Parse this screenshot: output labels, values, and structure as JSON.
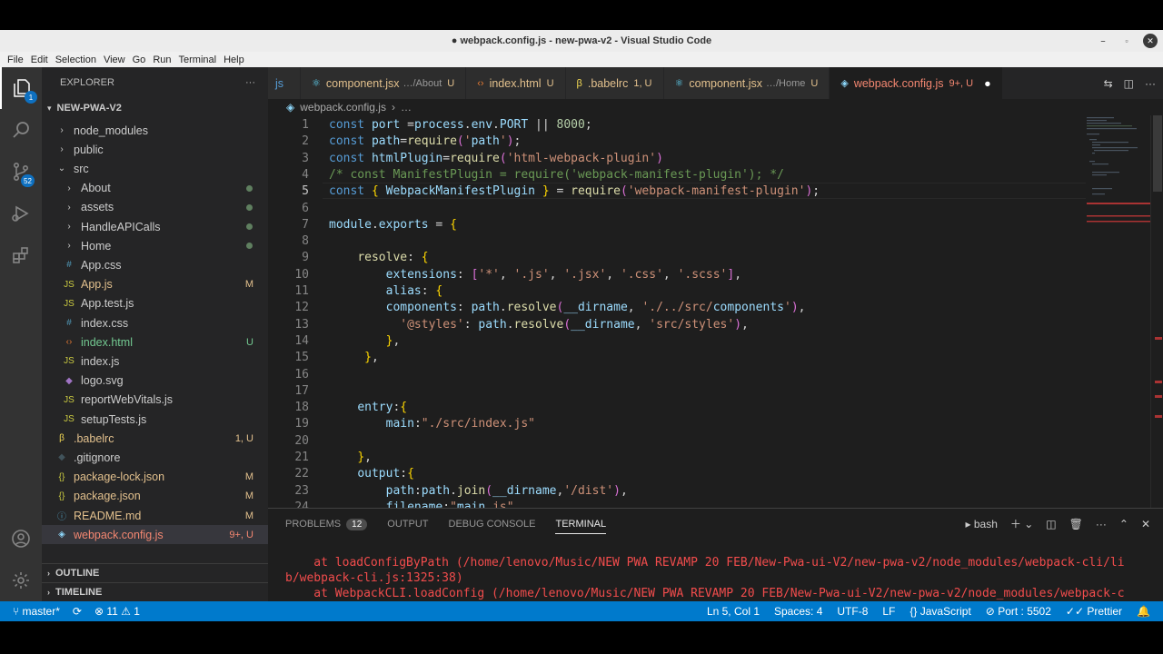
{
  "window": {
    "title": "● webpack.config.js - new-pwa-v2 - Visual Studio Code"
  },
  "menu": [
    "File",
    "Edit",
    "Selection",
    "View",
    "Go",
    "Run",
    "Terminal",
    "Help"
  ],
  "activity": {
    "explorer_badge": "1",
    "scm_badge": "52"
  },
  "explorer": {
    "header": "EXPLORER",
    "more": "···",
    "project": "NEW-PWA-V2",
    "items": [
      {
        "label": "node_modules",
        "kind": "folder",
        "indent": 1,
        "status": ""
      },
      {
        "label": "public",
        "kind": "folder",
        "indent": 1,
        "status": ""
      },
      {
        "label": "src",
        "kind": "folder-open",
        "indent": 1,
        "status": ""
      },
      {
        "label": "About",
        "kind": "folder",
        "indent": 2,
        "status": "dot"
      },
      {
        "label": "assets",
        "kind": "folder",
        "indent": 2,
        "status": "dot"
      },
      {
        "label": "HandleAPICalls",
        "kind": "folder",
        "indent": 2,
        "status": "dot"
      },
      {
        "label": "Home",
        "kind": "folder",
        "indent": 2,
        "status": "dot"
      },
      {
        "label": "App.css",
        "kind": "css",
        "indent": 2,
        "status": ""
      },
      {
        "label": "App.js",
        "kind": "js",
        "indent": 2,
        "status": "M"
      },
      {
        "label": "App.test.js",
        "kind": "js",
        "indent": 2,
        "status": ""
      },
      {
        "label": "index.css",
        "kind": "css",
        "indent": 2,
        "status": ""
      },
      {
        "label": "index.html",
        "kind": "html",
        "indent": 2,
        "status": "U"
      },
      {
        "label": "index.js",
        "kind": "js",
        "indent": 2,
        "status": ""
      },
      {
        "label": "logo.svg",
        "kind": "svg",
        "indent": 2,
        "status": ""
      },
      {
        "label": "reportWebVitals.js",
        "kind": "js",
        "indent": 2,
        "status": ""
      },
      {
        "label": "setupTests.js",
        "kind": "js",
        "indent": 2,
        "status": ""
      },
      {
        "label": ".babelrc",
        "kind": "babel",
        "indent": 1,
        "status": "1, U"
      },
      {
        "label": ".gitignore",
        "kind": "git",
        "indent": 1,
        "status": ""
      },
      {
        "label": "package-lock.json",
        "kind": "json",
        "indent": 1,
        "status": "M"
      },
      {
        "label": "package.json",
        "kind": "json",
        "indent": 1,
        "status": "M"
      },
      {
        "label": "README.md",
        "kind": "info",
        "indent": 1,
        "status": "M"
      },
      {
        "label": "webpack.config.js",
        "kind": "webpack",
        "indent": 1,
        "status": "9+, U"
      }
    ],
    "outline": "OUTLINE",
    "timeline": "TIMELINE"
  },
  "tabs": [
    {
      "label": "js",
      "desc": "",
      "status": ""
    },
    {
      "label": "component.jsx",
      "desc": "…/About",
      "status": "U"
    },
    {
      "label": "index.html",
      "desc": "",
      "status": "U"
    },
    {
      "label": ".babelrc",
      "desc": "",
      "status": "1, U"
    },
    {
      "label": "component.jsx",
      "desc": "…/Home",
      "status": "U"
    },
    {
      "label": "webpack.config.js",
      "desc": "",
      "status": "9+, U"
    }
  ],
  "breadcrumb": {
    "file": "webpack.config.js",
    "more": "…"
  },
  "editor": {
    "line_numbers": [
      "1",
      "2",
      "3",
      "4",
      "5",
      "6",
      "7",
      "8",
      "9",
      "10",
      "11",
      "12",
      "13",
      "14",
      "15",
      "16",
      "17",
      "18",
      "19",
      "20",
      "21",
      "22",
      "23",
      "24"
    ],
    "current_line": "5",
    "lines": [
      "const port =process.env.PORT || 8000;",
      "const path=require('path');",
      "const htmlPlugin=require('html-webpack-plugin')",
      "/* const ManifestPlugin = require('webpack-manifest-plugin'); */",
      "const { WebpackManifestPlugin } = require('webpack-manifest-plugin');",
      "",
      "module.exports = {",
      "",
      "    resolve: {",
      "        extensions: ['*', '.js', '.jsx', '.css', '.scss'],",
      "        alias: {",
      "        components: path.resolve(__dirname, './../src/components'),",
      "          '@styles': path.resolve(__dirname, 'src/styles'),",
      "        },",
      "     },",
      "",
      "",
      "    entry:{",
      "        main:\"./src/index.js\"",
      "",
      "    },",
      "    output:{",
      "        path:path.join(__dirname,'/dist'),",
      "        filename:\"main.js\""
    ]
  },
  "panel": {
    "tabs": [
      "PROBLEMS",
      "OUTPUT",
      "DEBUG CONSOLE",
      "TERMINAL"
    ],
    "problems_count": "12",
    "active": "TERMINAL",
    "shell": "bash",
    "terminal_lines": [
      "    at loadConfigByPath (/home/lenovo/Music/NEW PWA REVAMP 20 FEB/New-Pwa-ui-V2/new-pwa-v2/node_modules/webpack-cli/li",
      "b/webpack-cli.js:1325:38)",
      "    at WebpackCLI.loadConfig (/home/lenovo/Music/NEW PWA REVAMP 20 FEB/New-Pwa-ui-V2/new-pwa-v2/node_modules/webpack-c"
    ]
  },
  "status": {
    "branch": "master*",
    "errors": "11",
    "warnings": "1",
    "position": "Ln 5, Col 1",
    "spaces": "Spaces: 4",
    "encoding": "UTF-8",
    "eol": "LF",
    "language": "JavaScript",
    "port": "Port : 5502",
    "prettier": "Prettier"
  }
}
